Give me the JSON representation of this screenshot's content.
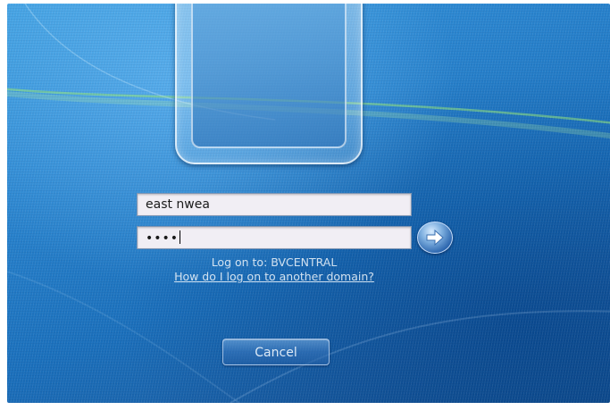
{
  "login": {
    "username_value": "east nwea",
    "password_mask": "••••",
    "logon_to_text": "Log on to: BVCENTRAL",
    "domain_help_link": "How do I log on to another domain?",
    "cancel_label": "Cancel",
    "submit_icon": "arrow-right-icon"
  },
  "colors": {
    "wallpaper": "#1a6fbb",
    "field_bg": "#f1eef4",
    "text_light": "#e1ebf5"
  }
}
